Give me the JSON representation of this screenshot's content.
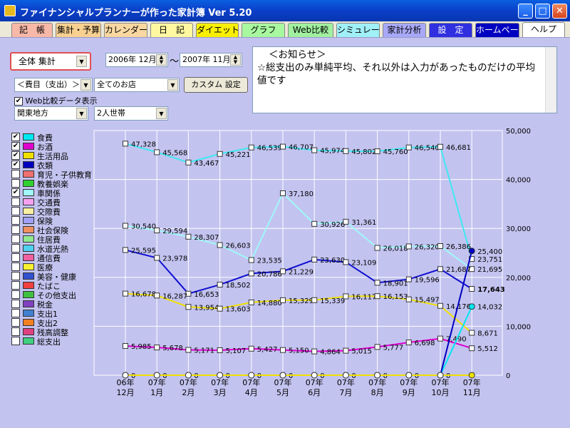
{
  "window": {
    "title": "ファイナンシャルプランナーが作った家計簿 Ver 5.20"
  },
  "tabs": [
    {
      "label": "記　帳",
      "color": "#f8b8a8",
      "active": false
    },
    {
      "label": "集計・予算",
      "color": "#f8d090",
      "active": false
    },
    {
      "label": "カレンダー",
      "color": "#f8d8a0",
      "active": false
    },
    {
      "label": "日　記",
      "color": "#fff8a0",
      "active": false
    },
    {
      "label": "ダイエット",
      "color": "#f8f000",
      "active": false
    },
    {
      "label": "グラフ",
      "color": "#a8f8a0",
      "active": false
    },
    {
      "label": "Web比較",
      "color": "#a0f0a0",
      "active": false
    },
    {
      "label": "シミュレーション",
      "color": "#a0f0f8",
      "active": false
    },
    {
      "label": "家計分析",
      "color": "#a8a8f8",
      "active": false
    },
    {
      "label": "設　定",
      "color": "#3030e0",
      "active": false
    },
    {
      "label": "ホームページ",
      "color": "#0000c0",
      "active": false
    },
    {
      "label": "ヘルプ",
      "color": "#ffffff",
      "active": true
    }
  ],
  "controls": {
    "summary_select": "全体 集計",
    "start_date": "2006年 12月",
    "date_sep": "〜",
    "end_date": "2007年 11月",
    "category_select": "＜費目（支出）＞",
    "store_select": "全てのお店",
    "custom_button": "カスタム 設定",
    "web_compare_label": "Web比較データ表示",
    "region_select": "関東地方",
    "household_select": "2人世帯"
  },
  "notice": {
    "title": "＜お知らせ＞",
    "body": "☆総支出のみ単純平均、それ以外は入力があったものだけの平均値です"
  },
  "legend": [
    {
      "label": "食費",
      "color": "#00e8f0",
      "checked": true
    },
    {
      "label": "お酒",
      "color": "#e000d0",
      "checked": true
    },
    {
      "label": "生活用品",
      "color": "#f0e000",
      "checked": true
    },
    {
      "label": "衣類",
      "color": "#0000c0",
      "checked": true
    },
    {
      "label": "育児・子供教育",
      "color": "#f07070",
      "checked": false
    },
    {
      "label": "教養娯楽",
      "color": "#30d030",
      "checked": false
    },
    {
      "label": "車関係",
      "color": "#a0f8f8",
      "checked": true
    },
    {
      "label": "交通費",
      "color": "#f8a0f0",
      "checked": false
    },
    {
      "label": "交際費",
      "color": "#f8f0a0",
      "checked": false
    },
    {
      "label": "保険",
      "color": "#a0a0f8",
      "checked": false
    },
    {
      "label": "社会保険",
      "color": "#f09060",
      "checked": false
    },
    {
      "label": "住居費",
      "color": "#90e890",
      "checked": false
    },
    {
      "label": "水道光熱",
      "color": "#50d0f0",
      "checked": false
    },
    {
      "label": "通信費",
      "color": "#f060a0",
      "checked": false
    },
    {
      "label": "医療",
      "color": "#f8f030",
      "checked": false
    },
    {
      "label": "美容・健康",
      "color": "#3050d0",
      "checked": false
    },
    {
      "label": "たばこ",
      "color": "#f04040",
      "checked": false
    },
    {
      "label": "その他支出",
      "color": "#40c040",
      "checked": false
    },
    {
      "label": "税金",
      "color": "#8040c0",
      "checked": false
    },
    {
      "label": "支出1",
      "color": "#4080d0",
      "checked": false
    },
    {
      "label": "支出2",
      "color": "#f08020",
      "checked": false
    },
    {
      "label": "残高調整",
      "color": "#e04080",
      "checked": false
    },
    {
      "label": "総支出",
      "color": "#40d080",
      "checked": false
    }
  ],
  "chart_data": {
    "type": "line",
    "categories": [
      "06年 12月",
      "07年 1月",
      "07年 2月",
      "07年 3月",
      "07年 4月",
      "07年 5月",
      "07年 6月",
      "07年 7月",
      "07年 8月",
      "07年 9月",
      "07年 10月",
      "07年 11月"
    ],
    "ylim": [
      0,
      50000
    ],
    "yticks": [
      "0",
      "10,000",
      "20,000",
      "30,000",
      "40,000",
      "50,000"
    ],
    "grid": true,
    "series": [
      {
        "color": "#40e8f0",
        "marker": "square",
        "values": [
          47328,
          45568,
          43467,
          45221,
          46539,
          46707,
          45974,
          45802,
          45760,
          46540,
          46681,
          23751
        ],
        "labels": [
          "47,328",
          "45,568",
          "43,467",
          "45,221",
          "46,539",
          "46,707",
          "45,974",
          "45,802",
          "45,760",
          "46,540",
          "46,681",
          "23,751"
        ]
      },
      {
        "color": "#a0f8f8",
        "marker": "square",
        "values": [
          30540,
          29594,
          28307,
          26603,
          23535,
          37180,
          30926,
          31361,
          26018,
          26320,
          26386,
          21695
        ],
        "labels": [
          "30,540",
          "29,594",
          "28,307",
          "26,603",
          "23,535",
          "37,180",
          "30,926",
          "31,361",
          "26,018",
          "26,320",
          "26,386",
          "21,695"
        ]
      },
      {
        "color": "#1010d0",
        "marker": "square",
        "values": [
          25595,
          23978,
          16653,
          18502,
          20786,
          21229,
          23630,
          23109,
          18901,
          19596,
          21687,
          17643
        ],
        "labels": [
          "25,595",
          "23,978",
          "16,653",
          "18,502",
          "20,786",
          "21,229",
          "23,630",
          "23,109",
          "18,901",
          "19,596",
          "21,687",
          "17,643"
        ]
      },
      {
        "color": "#f0e000",
        "marker": "square",
        "values": [
          16678,
          16287,
          13954,
          13603,
          14880,
          15329,
          15339,
          16117,
          16153,
          15497,
          14176,
          8671
        ],
        "labels": [
          "16,678",
          "16,287",
          "13,954",
          "13,603",
          "14,880",
          "15,329",
          "15,339",
          "16,117",
          "16,153",
          "15,497",
          "14,176",
          "8,671"
        ]
      },
      {
        "color": "#e000d0",
        "marker": "square",
        "values": [
          5985,
          5678,
          5171,
          5107,
          5427,
          5150,
          4864,
          5015,
          5777,
          6698,
          7490,
          5512
        ],
        "labels": [
          "5,985",
          "5,678",
          "5,171",
          "5,107",
          "5,427",
          "5,150",
          "4,864",
          "5,015",
          "5,777",
          "6,698",
          "7,490",
          "5,512"
        ]
      },
      {
        "color": "#00e8f0",
        "marker": "circle",
        "values": [
          0,
          0,
          0,
          0,
          0,
          0,
          0,
          0,
          0,
          0,
          0,
          14032
        ],
        "labels": [
          "0",
          "0",
          "0",
          "0",
          "0",
          "0",
          "0",
          "0",
          "0",
          "0",
          "0",
          "14,032"
        ]
      },
      {
        "color": "#0000c0",
        "marker": "circle",
        "values": [
          0,
          0,
          0,
          0,
          0,
          0,
          0,
          0,
          0,
          0,
          0,
          25400
        ],
        "labels": [
          "",
          "",
          "",
          "",
          "",
          "",
          "",
          "",
          "",
          "",
          "",
          "25,400"
        ]
      },
      {
        "color": "#f0e000",
        "marker": "circle",
        "values": [
          0,
          0,
          0,
          0,
          0,
          0,
          0,
          0,
          0,
          0,
          0,
          0
        ],
        "labels": [
          "",
          "",
          "",
          "",
          "",
          "",
          "",
          "",
          "",
          "",
          "",
          ""
        ]
      }
    ]
  }
}
